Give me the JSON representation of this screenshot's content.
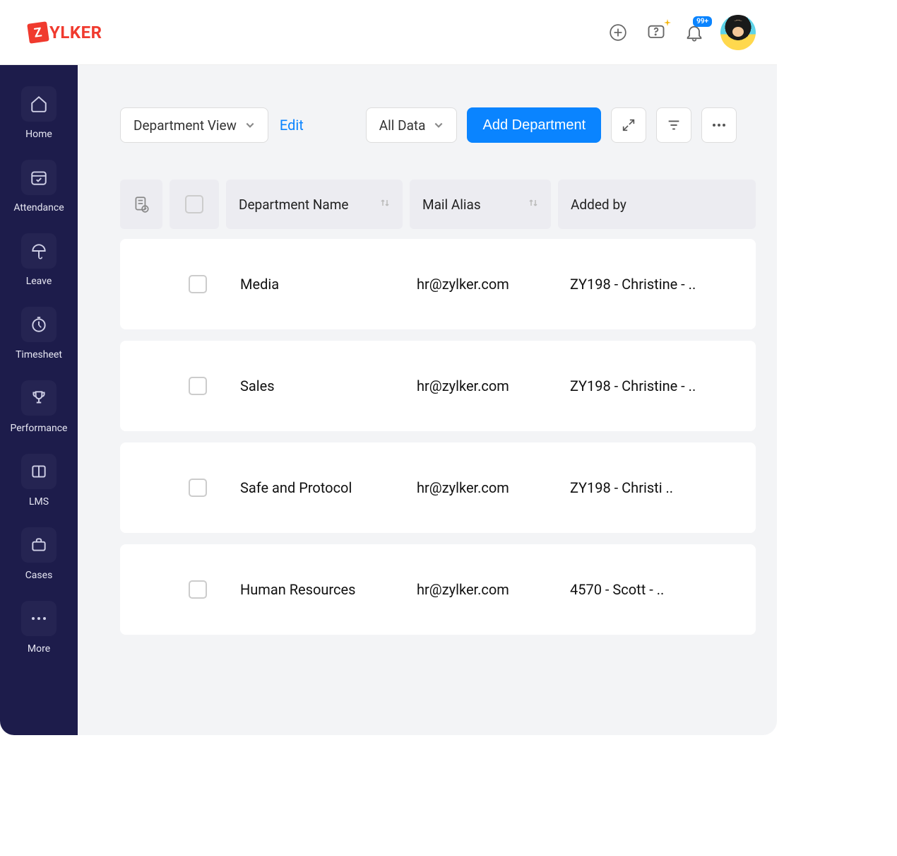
{
  "brand": {
    "initial": "Z",
    "name": "YLKER"
  },
  "header": {
    "notification_badge": "99+"
  },
  "sidebar": {
    "items": [
      {
        "label": "Home"
      },
      {
        "label": "Attendance"
      },
      {
        "label": "Leave"
      },
      {
        "label": "Timesheet"
      },
      {
        "label": "Performance"
      },
      {
        "label": "LMS"
      },
      {
        "label": "Cases"
      },
      {
        "label": "More"
      }
    ]
  },
  "toolbar": {
    "view_dropdown": "Department View",
    "edit_label": "Edit",
    "data_dropdown": "All Data",
    "add_button": "Add Department"
  },
  "columns": {
    "name": "Department Name",
    "mail": "Mail Alias",
    "added": "Added by"
  },
  "rows": [
    {
      "name": "Media",
      "mail": "hr@zylker.com",
      "added": "ZY198 - Christine - .."
    },
    {
      "name": "Sales",
      "mail": "hr@zylker.com",
      "added": "ZY198 - Christine - .."
    },
    {
      "name": "Safe and Protocol",
      "mail": "hr@zylker.com",
      "added": "ZY198 - Christi .."
    },
    {
      "name": "Human Resources",
      "mail": "hr@zylker.com",
      "added": "4570 - Scott - .."
    }
  ]
}
